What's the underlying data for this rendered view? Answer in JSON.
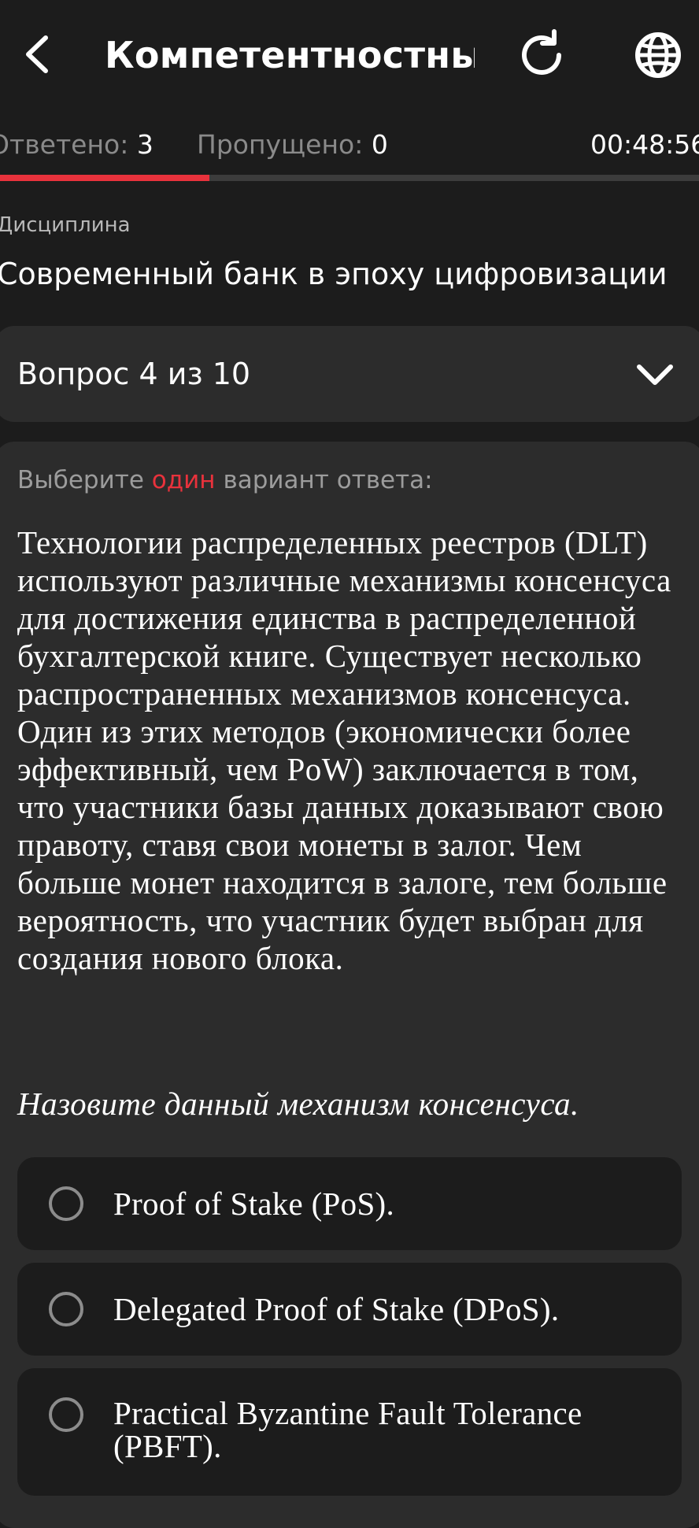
{
  "header": {
    "title": "Компетентностны...",
    "back_icon": "chevron-left-icon",
    "reload_icon": "reload-icon",
    "language_icon": "globe-icon"
  },
  "stats": {
    "answered_label": "Ответено:",
    "answered_value": "3",
    "skipped_label": "Пропущено:",
    "skipped_value": "0",
    "timer": "00:48:56",
    "progress_fraction": 0.3
  },
  "discipline": {
    "label": "Дисциплина",
    "name": "Современный банк в эпоху цифровизации"
  },
  "question_selector": {
    "label": "Вопрос 4 из 10",
    "icon": "chevron-down-icon"
  },
  "question": {
    "instruction_prefix": "Выберите",
    "instruction_accent": "один",
    "instruction_suffix": "вариант ответа:",
    "text": "Технологии распределенных реестров (DLT) используют различные механизмы консенсуса для достижения единства в распределенной бухгалтерской книге. Существует несколько распространенных механизмов консенсуса. Один из этих методов (экономически более эффективный, чем PoW) заключается в том, что участники базы данных доказывают свою правоту, ставя свои монеты в залог. Чем больше монет находится в залоге, тем больше вероятность, что участник будет выбран для создания нового блока.",
    "prompt": "Назовите данный механизм консенсуса.",
    "options": [
      {
        "label": "Proof of Stake (PoS)."
      },
      {
        "label": "Delegated Proof of Stake (DPoS)."
      },
      {
        "label": "Practical Byzantine Fault Tolerance (PBFT)."
      }
    ]
  },
  "colors": {
    "background": "#1c1c1c",
    "card": "#2c2c2c",
    "accent": "#e8323c",
    "muted_text": "#9c9c9c"
  }
}
